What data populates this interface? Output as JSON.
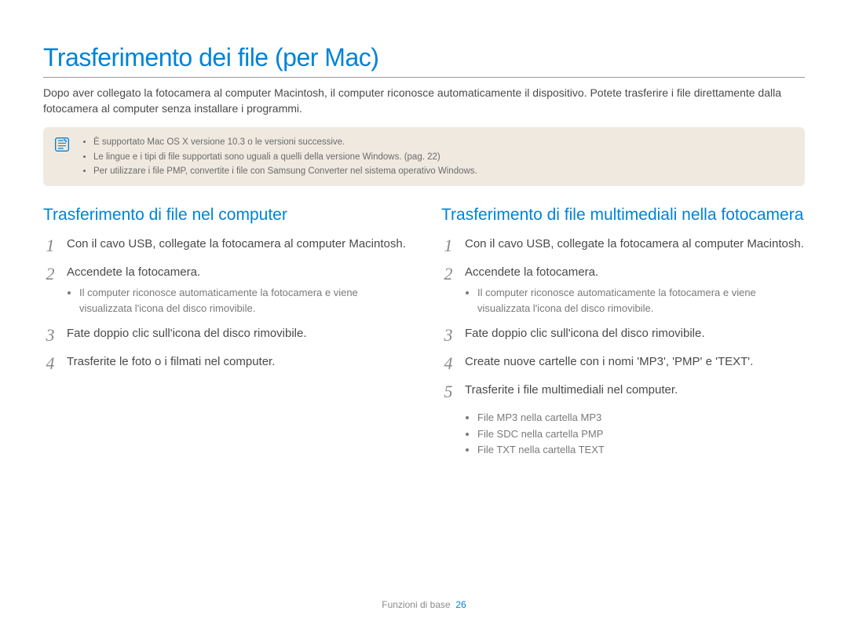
{
  "title": "Trasferimento dei file (per Mac)",
  "intro": "Dopo aver collegato la fotocamera al computer Macintosh, il computer riconosce automaticamente il dispositivo. Potete trasferire i file direttamente dalla fotocamera al computer senza installare i programmi.",
  "note": {
    "icon": "note-icon",
    "items": [
      "È supportato Mac OS X versione 10.3 o le versioni successive.",
      "Le lingue e i tipi di file supportati sono uguali a quelli della versione Windows. (pag. 22)",
      "Per utilizzare i file PMP, convertite i file con Samsung Converter nel sistema operativo Windows."
    ]
  },
  "left": {
    "heading": "Trasferimento di file nel computer",
    "steps": [
      {
        "num": "1",
        "text": "Con il cavo USB, collegate la fotocamera al computer Macintosh."
      },
      {
        "num": "2",
        "text": "Accendete la fotocamera.",
        "sub": [
          "Il computer riconosce automaticamente la fotocamera e viene visualizzata l'icona del disco rimovibile."
        ]
      },
      {
        "num": "3",
        "text": "Fate doppio clic sull'icona del disco rimovibile."
      },
      {
        "num": "4",
        "text": "Trasferite le foto o i filmati nel computer."
      }
    ]
  },
  "right": {
    "heading": "Trasferimento di file multimediali nella fotocamera",
    "steps": [
      {
        "num": "1",
        "text": "Con il cavo USB, collegate la fotocamera al computer Macintosh."
      },
      {
        "num": "2",
        "text": "Accendete la fotocamera.",
        "sub": [
          "Il computer riconosce automaticamente la fotocamera e viene visualizzata l'icona del disco rimovibile."
        ]
      },
      {
        "num": "3",
        "text": "Fate doppio clic sull'icona del disco rimovibile."
      },
      {
        "num": "4",
        "text": "Create nuove cartelle con i nomi 'MP3', 'PMP' e 'TEXT'."
      },
      {
        "num": "5",
        "text": "Trasferite i file multimediali nel computer.",
        "sub_after": [
          "File MP3 nella cartella MP3",
          "File SDC nella cartella PMP",
          "File TXT nella cartella TEXT"
        ]
      }
    ]
  },
  "footer": {
    "section": "Funzioni di base",
    "page": "26"
  }
}
